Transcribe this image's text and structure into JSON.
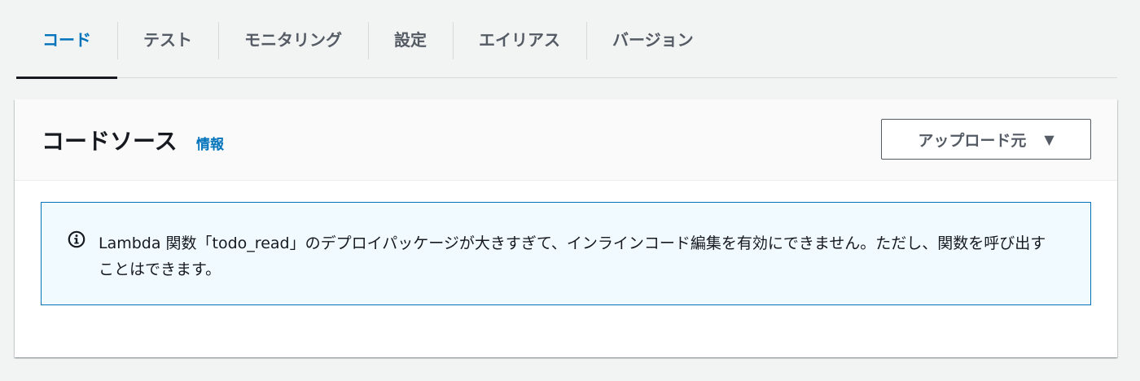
{
  "tabs": [
    {
      "label": "コード",
      "active": true
    },
    {
      "label": "テスト",
      "active": false
    },
    {
      "label": "モニタリング",
      "active": false
    },
    {
      "label": "設定",
      "active": false
    },
    {
      "label": "エイリアス",
      "active": false
    },
    {
      "label": "バージョン",
      "active": false
    }
  ],
  "panel": {
    "title": "コードソース",
    "info_link": "情報",
    "upload_button": "アップロード元",
    "upload_caret": "▼"
  },
  "alert": {
    "icon": "info-icon",
    "message": "Lambda 関数「todo_read」のデプロイパッケージが大きすぎて、インラインコード編集を有効にできません。ただし、関数を呼び出すことはできます。"
  },
  "colors": {
    "accent": "#0073bb",
    "alert_background": "#f1faff",
    "page_background": "#f2f3f3"
  }
}
